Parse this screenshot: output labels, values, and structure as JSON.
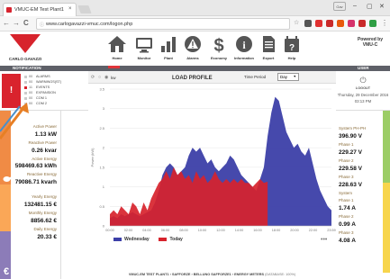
{
  "browser": {
    "tab_title": "VMUC-EM Test Plant1",
    "tab_close": "×",
    "url": "www.carlogavazzi-vmuc.com/logon.php",
    "back": "←",
    "forward": "→",
    "reload": "C",
    "info": "ⓘ",
    "minimize": "–",
    "maximize": "▢",
    "close": "✕",
    "user_button": "Gav"
  },
  "header": {
    "logo_text": "CARLO GAVAZZI",
    "nav": [
      {
        "label": "Home",
        "icon": "home-icon"
      },
      {
        "label": "Monitor",
        "icon": "monitor-icon"
      },
      {
        "label": "Plant",
        "icon": "bar-chart-icon"
      },
      {
        "label": "Alarms",
        "icon": "alarm-triangle-icon"
      },
      {
        "label": "Economy",
        "icon": "dollar-icon"
      },
      {
        "label": "Information",
        "icon": "info-icon"
      },
      {
        "label": "Export",
        "icon": "document-icon"
      },
      {
        "label": "Help",
        "icon": "help-icon"
      }
    ],
    "powered_by": "Powered by",
    "powered_product": "VMU-C"
  },
  "section_bar": {
    "notification": "NOTIFICATION",
    "user": "USER"
  },
  "notification": {
    "icon": "!",
    "rows": [
      {
        "count": "00",
        "label": "ALARMS",
        "red": false
      },
      {
        "count": "00",
        "label": "WARNINGS(ST)",
        "red": false
      },
      {
        "count": "11",
        "label": "EVENTS",
        "red": true
      },
      {
        "count": "00",
        "label": "EXPANSION",
        "red": false
      },
      {
        "count": "00",
        "label": "COM 1",
        "red": false
      },
      {
        "count": "00",
        "label": "COM 2",
        "red": false
      }
    ]
  },
  "stats": {
    "active_power_label": "Active Power",
    "active_power": "1.13 kW",
    "reactive_power_label": "Reactive Power",
    "reactive_power": "0.26 kvar",
    "active_energy_label": "Active Energy",
    "active_energy": "598469.63 kWh",
    "reactive_energy_label": "Reactive Energy",
    "reactive_energy": "79086.71 kvarh",
    "yearly_energy_label": "Yearly Energy",
    "yearly_energy": "132481.15 €",
    "monthly_energy_label": "Monthly Energy",
    "monthly_energy": "8856.62 €",
    "daily_energy_label": "Daily Energy",
    "daily_energy": "20.33 €"
  },
  "chart_panel": {
    "title": "LOAD PROFILE",
    "time_period_label": "Time Period",
    "time_period_value": "Day",
    "unit_option": "kw",
    "more": "•••"
  },
  "chart_data": {
    "type": "area",
    "ylabel": "Power (kW)",
    "ylim": [
      0,
      3.5
    ],
    "yticks": [
      "3.5",
      "3",
      "2.5",
      "2",
      "1.5",
      "1",
      "0.5",
      "0"
    ],
    "xticks": [
      "00:00",
      "02:00",
      "04:00",
      "06:00",
      "08:00",
      "10:00",
      "12:00",
      "14:00",
      "16:00",
      "18:00",
      "20:00",
      "22:00",
      "23:59"
    ],
    "grid": true,
    "legend_position": "bottom-left",
    "series": [
      {
        "name": "Wednesday",
        "color": "#3c3fa8",
        "values": [
          0.2,
          0.25,
          0.2,
          0.3,
          0.25,
          0.3,
          0.35,
          0.3,
          0.25,
          0.3,
          0.35,
          0.4,
          0.6,
          0.9,
          1.3,
          1.5,
          1.6,
          1.5,
          1.3,
          1.4,
          1.5,
          1.8,
          2.0,
          1.9,
          2.0,
          1.8,
          1.6,
          1.7,
          1.5,
          1.4,
          1.5,
          1.6,
          1.8,
          1.7,
          1.5,
          1.3,
          1.2,
          1.1,
          1.0,
          0.9,
          1.2,
          1.5,
          2.3,
          2.9,
          3.3,
          3.2,
          2.8,
          2.4,
          2.2,
          2.0,
          2.1,
          1.9,
          1.8,
          2.0,
          1.6,
          1.2,
          0.9,
          0.7,
          0.5,
          0.4
        ]
      },
      {
        "name": "Today",
        "color": "#d7232c",
        "values": [
          0.3,
          0.4,
          0.3,
          0.5,
          0.4,
          0.3,
          0.6,
          0.5,
          0.3,
          0.6,
          0.4,
          0.7,
          0.9,
          1.1,
          1.2,
          1.4,
          1.2,
          1.5,
          1.3,
          1.4,
          1.2,
          1.3,
          1.1,
          1.4,
          1.2,
          1.3,
          1.1,
          1.2,
          1.4,
          1.2,
          1.1,
          1.2,
          1.1,
          1.2,
          1.1,
          1.2,
          1.1,
          1.1,
          1.0,
          1.1,
          1.2,
          1.1,
          1.13,
          null,
          null,
          null,
          null,
          null,
          null,
          null,
          null,
          null,
          null,
          null,
          null,
          null,
          null,
          null,
          null,
          null
        ]
      }
    ]
  },
  "user": {
    "power_icon": "⏻",
    "logout": "LOGOUT",
    "date": "Thursday, 29 December 2016",
    "time": "03:13 PM"
  },
  "meter": {
    "title": "System PH-PH",
    "system_v": "396.90 V",
    "phase1_label": "Phase 1",
    "phase1_v": "229.27 V",
    "phase2_label": "Phase 2",
    "phase2_v": "229.58 V",
    "phase3_label": "Phase 3",
    "phase3_v": "228.63 V",
    "system_a_label": "System",
    "phase1a_label": "Phase 1",
    "phase1_a": "1.74 A",
    "phase2a_label": "Phase 2",
    "phase2_a": "0.99 A",
    "phase3a_label": "Phase 3",
    "phase3_a": "4.08 A"
  },
  "footer": {
    "text": "VMUC-EM TEST PLANT1 › SAFFORZE › BELLUNO SAFFORZE1 › ENERGY METERS",
    "suffix": "(DATABASE: 100%)"
  },
  "colors": {
    "brand_red": "#d7232c",
    "dark_bar": "#5e6068",
    "blue_series": "#3c3fa8"
  }
}
